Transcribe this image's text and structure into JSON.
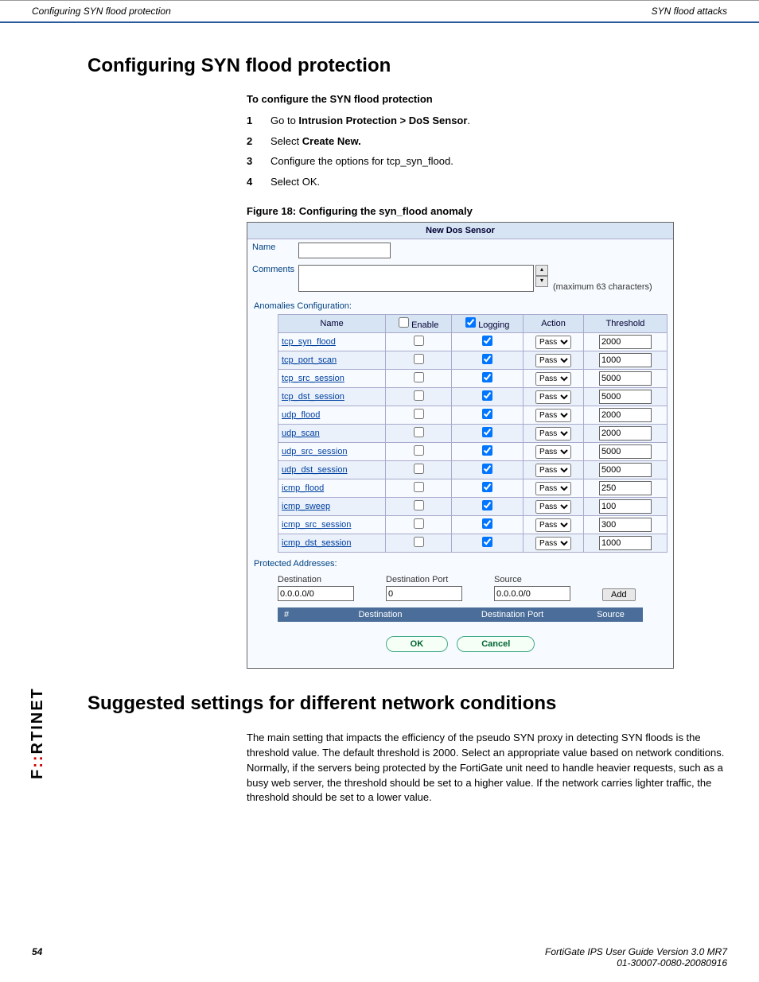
{
  "header": {
    "left": "Configuring SYN flood protection",
    "right": "SYN flood attacks"
  },
  "sections": {
    "title1": "Configuring SYN flood protection",
    "procTitle": "To configure the SYN flood protection",
    "steps": {
      "s1_pre": "Go to ",
      "s1_bold": "Intrusion Protection > DoS Sensor",
      "s1_post": ".",
      "s2_pre": "Select ",
      "s2_bold": "Create New.",
      "s3": "Configure the options for tcp_syn_flood.",
      "s4": "Select OK."
    },
    "figCaption": "Figure 18: Configuring the syn_flood anomaly",
    "title2": "Suggested settings for different network conditions",
    "para": "The main setting that impacts the efficiency of the pseudo SYN proxy in detecting SYN floods is the threshold value. The default threshold is 2000. Select an appropriate value based on network conditions. Normally, if the servers being protected by the FortiGate unit need to handle heavier requests, such as a busy web server, the threshold should be set to a higher value. If the network carries lighter traffic, the threshold should be set to a lower value."
  },
  "panel": {
    "title": "New Dos Sensor",
    "labels": {
      "name": "Name",
      "comments": "Comments",
      "maxChars": "(maximum 63 characters)"
    },
    "nameValue": "",
    "commentsValue": "",
    "anomHeader": "Anomalies Configuration:",
    "cols": {
      "name": "Name",
      "enable": "Enable",
      "logging": "Logging",
      "action": "Action",
      "threshold": "Threshold"
    },
    "actionOption": "Pass",
    "rows": [
      {
        "name": "tcp_syn_flood",
        "enable": false,
        "logging": true,
        "threshold": "2000"
      },
      {
        "name": "tcp_port_scan",
        "enable": false,
        "logging": true,
        "threshold": "1000"
      },
      {
        "name": "tcp_src_session",
        "enable": false,
        "logging": true,
        "threshold": "5000"
      },
      {
        "name": "tcp_dst_session",
        "enable": false,
        "logging": true,
        "threshold": "5000"
      },
      {
        "name": "udp_flood",
        "enable": false,
        "logging": true,
        "threshold": "2000"
      },
      {
        "name": "udp_scan",
        "enable": false,
        "logging": true,
        "threshold": "2000"
      },
      {
        "name": "udp_src_session",
        "enable": false,
        "logging": true,
        "threshold": "5000"
      },
      {
        "name": "udp_dst_session",
        "enable": false,
        "logging": true,
        "threshold": "5000"
      },
      {
        "name": "icmp_flood",
        "enable": false,
        "logging": true,
        "threshold": "250"
      },
      {
        "name": "icmp_sweep",
        "enable": false,
        "logging": true,
        "threshold": "100"
      },
      {
        "name": "icmp_src_session",
        "enable": false,
        "logging": true,
        "threshold": "300"
      },
      {
        "name": "icmp_dst_session",
        "enable": false,
        "logging": true,
        "threshold": "1000"
      }
    ],
    "protected": {
      "header": "Protected Addresses:",
      "destLabel": "Destination",
      "portLabel": "Destination Port",
      "srcLabel": "Source",
      "destVal": "0.0.0.0/0",
      "portVal": "0",
      "srcVal": "0.0.0.0/0",
      "addBtn": "Add",
      "listCols": {
        "del": "#",
        "dest": "Destination",
        "port": "Destination Port",
        "src": "Source"
      }
    },
    "buttons": {
      "ok": "OK",
      "cancel": "Cancel"
    }
  },
  "logo": {
    "f": "F",
    "mid1": "RTI",
    "mid2": "NET"
  },
  "footer": {
    "pageNum": "54",
    "line1": "FortiGate IPS User Guide Version 3.0 MR7",
    "line2": "01-30007-0080-20080916"
  }
}
